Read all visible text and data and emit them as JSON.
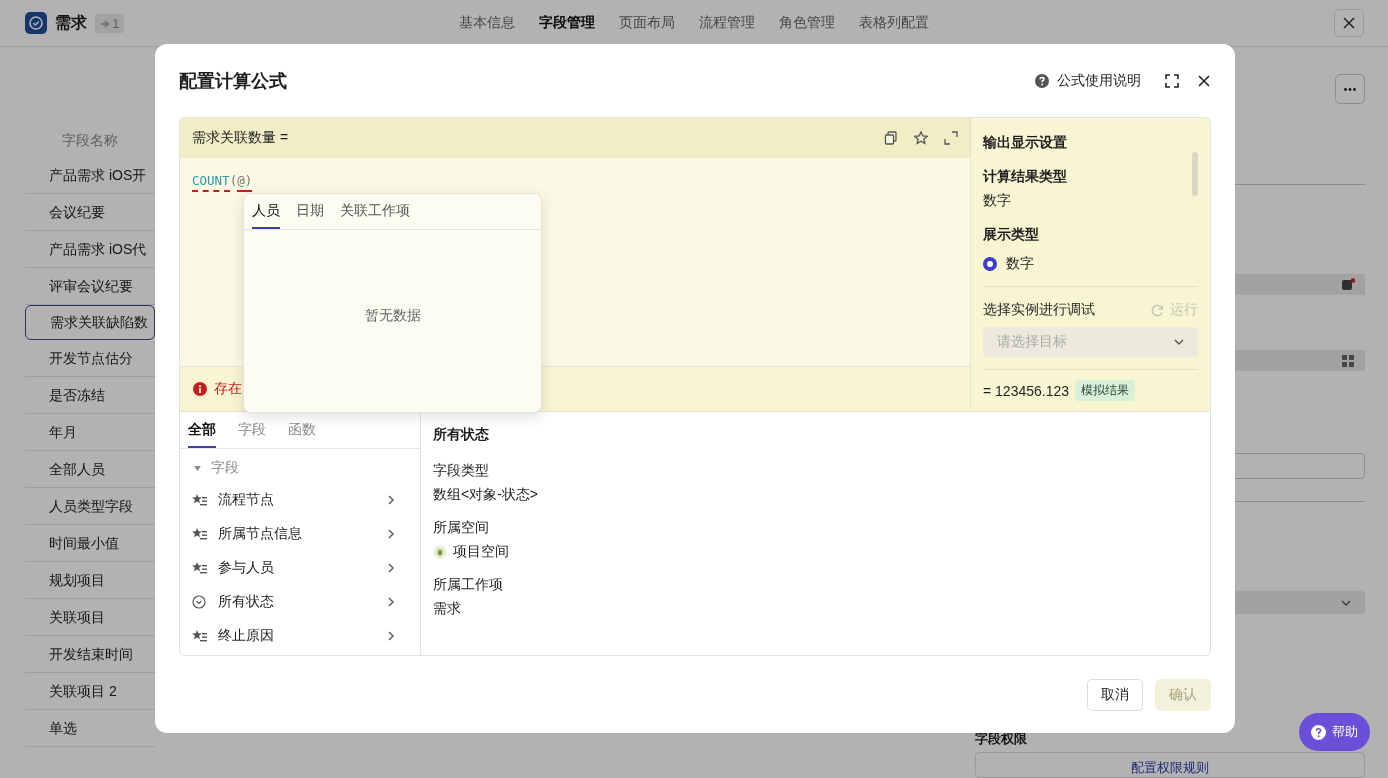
{
  "app": {
    "title": "需求",
    "badge": "1"
  },
  "nav_tabs": [
    {
      "label": "基本信息",
      "selected": false
    },
    {
      "label": "字段管理",
      "selected": true
    },
    {
      "label": "页面布局",
      "selected": false
    },
    {
      "label": "流程管理",
      "selected": false
    },
    {
      "label": "角色管理",
      "selected": false
    },
    {
      "label": "表格列配置",
      "selected": false
    }
  ],
  "field_list": {
    "heading": "字段名称",
    "items": [
      {
        "label": "产品需求 iOS开",
        "selected": false
      },
      {
        "label": "会议纪要",
        "selected": false
      },
      {
        "label": "产品需求 iOS代",
        "selected": false
      },
      {
        "label": "评审会议纪要",
        "selected": false
      },
      {
        "label": "需求关联缺陷数",
        "selected": true
      },
      {
        "label": "开发节点估分",
        "selected": false
      },
      {
        "label": "是否冻结",
        "selected": false
      },
      {
        "label": "年月",
        "selected": false
      },
      {
        "label": "全部人员",
        "selected": false
      },
      {
        "label": "人员类型字段",
        "selected": false
      },
      {
        "label": "时间最小值",
        "selected": false
      },
      {
        "label": "规划项目",
        "selected": false
      },
      {
        "label": "关联项目",
        "selected": false
      },
      {
        "label": "开发结束时间",
        "selected": false
      },
      {
        "label": "关联项目 2",
        "selected": false
      },
      {
        "label": "单选",
        "selected": false
      }
    ]
  },
  "side_panel": {
    "section_title": "字段权限",
    "link": "配置权限规则"
  },
  "help_button": "帮助",
  "dialog": {
    "title": "配置计算公式",
    "help_link": "公式使用说明",
    "formula_header": "需求关联数量 =",
    "formula_tokens": [
      {
        "text": "COUNT",
        "kind": "function",
        "error": true
      },
      {
        "text": "(",
        "kind": "punct",
        "error": false
      },
      {
        "text": "@",
        "kind": "punct",
        "error": true
      },
      {
        "text": ")",
        "kind": "punct",
        "error": true
      }
    ],
    "error": "存在",
    "mention_popup": {
      "tabs": [
        {
          "label": "人员",
          "selected": true
        },
        {
          "label": "日期",
          "selected": false
        },
        {
          "label": "关联工作项",
          "selected": false
        }
      ],
      "empty": "暂无数据"
    },
    "output": {
      "title": "输出显示设置",
      "result_type_label": "计算结果类型",
      "result_type": "数字",
      "display_type_label": "展示类型",
      "options": [
        {
          "label": "数字",
          "selected": true
        }
      ],
      "debug_label": "选择实例进行调试",
      "run_button": {
        "label": "运行",
        "disabled": true
      },
      "target_select": {
        "placeholder": "请选择目标"
      },
      "result": "= 123456.123",
      "result_tag": "模拟结果"
    },
    "browser": {
      "tabs": [
        {
          "label": "全部",
          "selected": true
        },
        {
          "label": "字段",
          "selected": false
        },
        {
          "label": "函数",
          "selected": false
        }
      ],
      "group": {
        "label": "字段",
        "expanded": true,
        "items": [
          {
            "label": "流程节点",
            "kind": "field"
          },
          {
            "label": "所属节点信息",
            "kind": "field"
          },
          {
            "label": "参与人员",
            "kind": "field"
          },
          {
            "label": "所有状态",
            "kind": "status"
          },
          {
            "label": "终止原因",
            "kind": "field"
          }
        ]
      }
    },
    "detail": {
      "title": "所有状态",
      "props": [
        {
          "label": "字段类型",
          "value": "数组<对象-状态>",
          "kind": "text"
        },
        {
          "label": "所属空间",
          "value": "项目空间",
          "kind": "space"
        },
        {
          "label": "所属工作项",
          "value": "需求",
          "kind": "text"
        }
      ]
    },
    "buttons": {
      "cancel": {
        "label": "取消",
        "disabled": false
      },
      "confirm": {
        "label": "确认",
        "disabled": true
      }
    }
  }
}
